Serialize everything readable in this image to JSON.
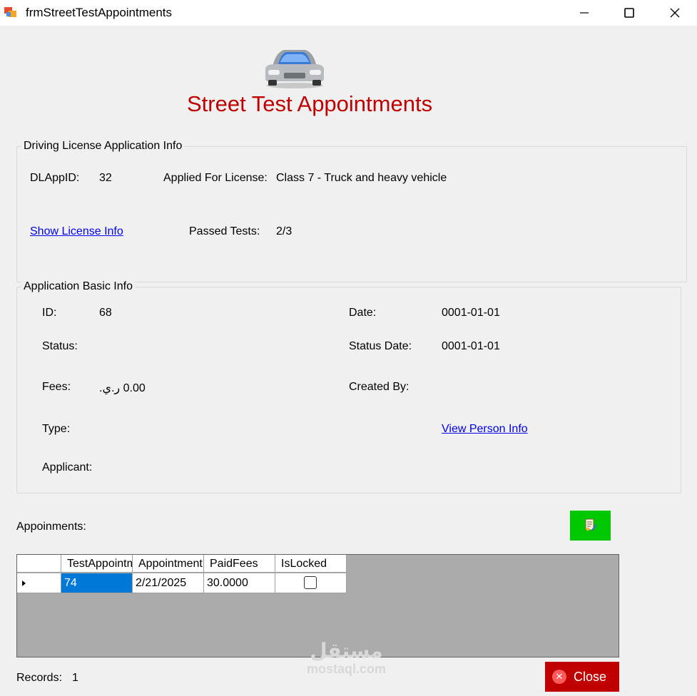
{
  "window": {
    "title": "frmStreetTestAppointments"
  },
  "header": {
    "title": "Street Test Appointments"
  },
  "dl_app_info": {
    "legend": "Driving License Application Info",
    "dl_app_id_label": "DLAppID:",
    "dl_app_id_value": "32",
    "applied_for_label": "Applied For License:",
    "applied_for_value": "Class 7 - Truck and heavy vehicle",
    "show_license_link": "Show License Info",
    "passed_tests_label": "Passed Tests:",
    "passed_tests_value": "2/3"
  },
  "basic_info": {
    "legend": "Application Basic Info",
    "id_label": "ID:",
    "id_value": "68",
    "status_label": "Status:",
    "status_value": "",
    "fees_label": "Fees:",
    "fees_value": "0.00 ر.ي.",
    "type_label": "Type:",
    "type_value": "",
    "applicant_label": "Applicant:",
    "applicant_value": "",
    "date_label": "Date:",
    "date_value": "0001-01-01",
    "status_date_label": "Status Date:",
    "status_date_value": "0001-01-01",
    "created_by_label": "Created By:",
    "created_by_value": "",
    "view_person_link": "View Person Info"
  },
  "appointments": {
    "label": "Appoinments:",
    "columns": [
      "TestAppointmentID",
      "AppointmentDate",
      "PaidFees",
      "IsLocked"
    ],
    "rows": [
      {
        "test_appointment_id": "74",
        "appointment_date": "2/21/2025",
        "paid_fees": "30.0000",
        "is_locked": false
      }
    ]
  },
  "footer": {
    "records_label": "Records:",
    "records_value": "1",
    "close_label": "Close"
  },
  "watermark": {
    "arabic": "مستقل",
    "latin": "mostaql.com"
  },
  "colors": {
    "title_red": "#c00000",
    "add_button_green": "#00c800",
    "close_button_red": "#c00000",
    "selection_blue": "#0078d7",
    "link_blue": "#0000ee"
  }
}
